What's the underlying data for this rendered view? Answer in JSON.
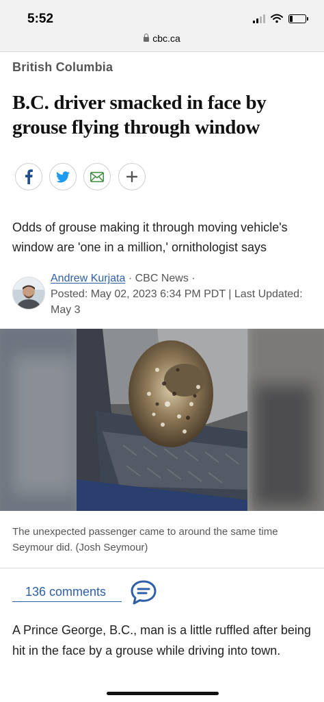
{
  "status_bar": {
    "time": "5:52",
    "battery_level": 0.2
  },
  "browser": {
    "url": "cbc.ca"
  },
  "article": {
    "section": "British Columbia",
    "headline": "B.C. driver smacked in face by grouse flying through window",
    "share_icons": [
      "facebook-icon",
      "twitter-icon",
      "email-icon",
      "plus-icon"
    ],
    "deck": "Odds of grouse making it through moving vehicle's window are 'one in a million,' ornithologist says",
    "author": "Andrew Kurjata",
    "byline_sep1": " · ",
    "outlet": "CBC News",
    "byline_sep2": " · ",
    "posted": "Posted: May 02, 2023 6:34 PM PDT | Last Updated: May 3",
    "photo_caption": "The unexpected passenger came to around the same time Seymour did. (Josh Seymour)",
    "comments_label": "136 comments",
    "body": "A Prince George, B.C.,  man is a little ruffled after being hit in the face by a grouse while driving into town."
  },
  "colors": {
    "link": "#2d5ea6",
    "twitter": "#1d9bf0",
    "facebook": "#1f4f8f",
    "email": "#3f8c3f"
  }
}
